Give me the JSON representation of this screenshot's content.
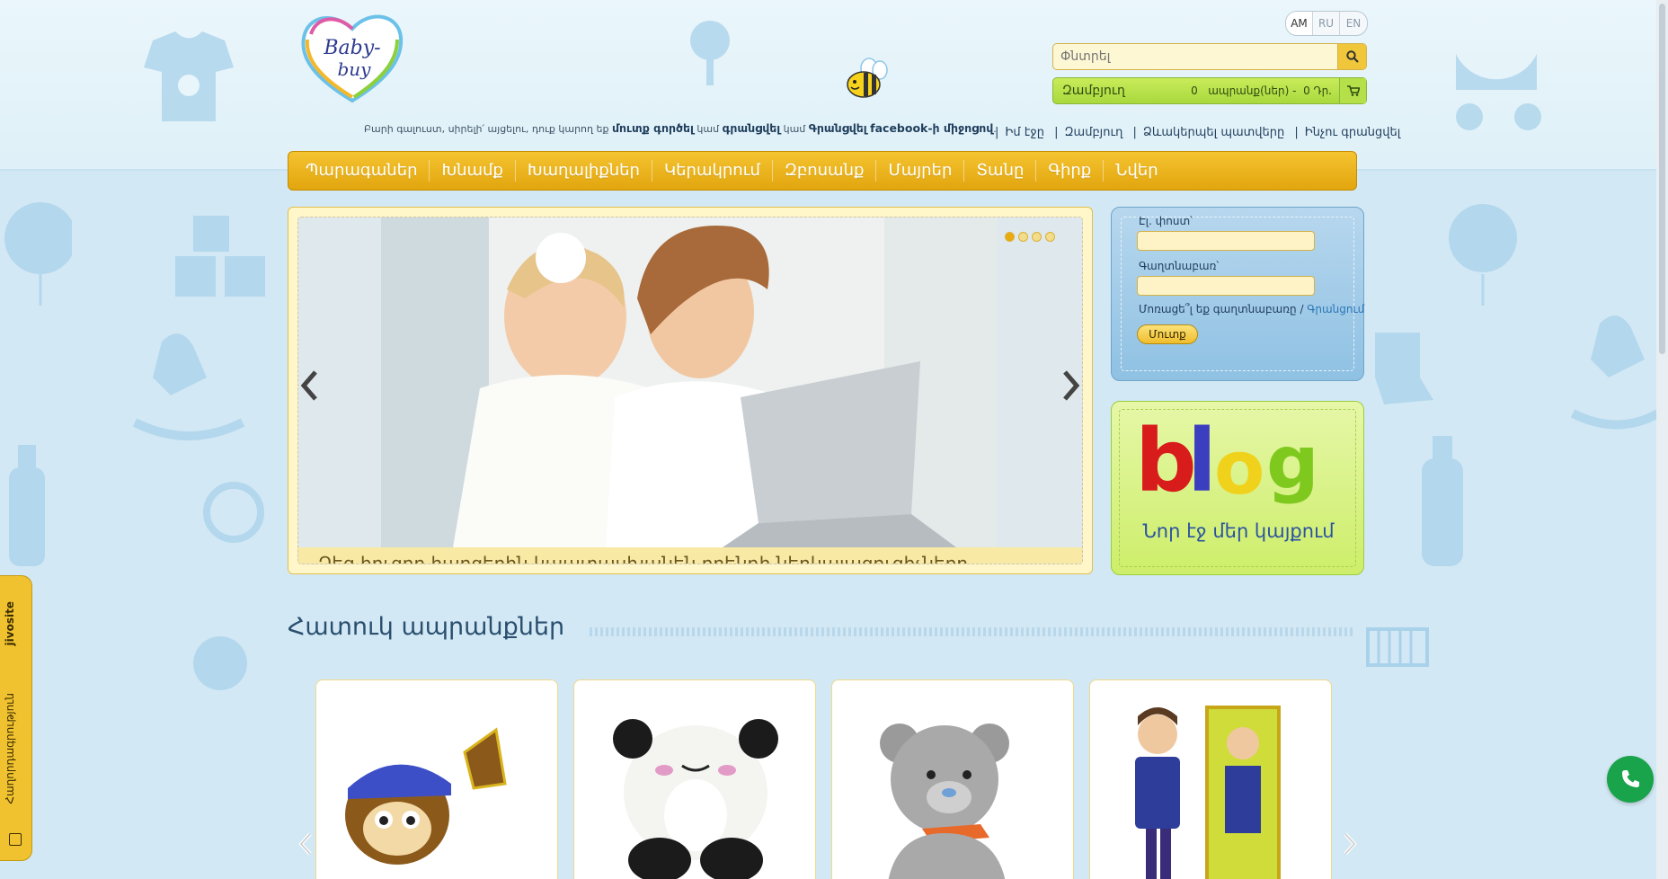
{
  "header": {
    "logo_text_1": "Baby-",
    "logo_text_2": "buy",
    "languages": [
      "AM",
      "RU",
      "EN"
    ],
    "active_language": "AM",
    "search_placeholder": "Փնտրել",
    "cart": {
      "label": "Զամբյուղ",
      "count": "0",
      "items_text": "ապրանք(ներ) -",
      "total": "0 Դր."
    },
    "welcome": {
      "prefix": "Բարի գալուստ, սիրելի՛ այցելու, դուք կարող եք",
      "login": "մուտք գործել",
      "or1": "կամ",
      "register": "գրանցվել",
      "or2": "կամ",
      "fb_register": "Գրանցվել",
      "fb_via": "facebook-ի միջոցով",
      "suffix": "."
    },
    "top_links": [
      "Իմ էջը",
      "Զամբյուղ",
      "Ձևակերպել պատվերը",
      "Ինչու գրանցվել"
    ]
  },
  "nav": {
    "items": [
      "Պարագաներ",
      "Խնամք",
      "Խաղալիքներ",
      "Կերակրում",
      "Զբոսանք",
      "Մայրեր",
      "Տանը",
      "Գիրք",
      "Նվեր"
    ]
  },
  "slider": {
    "caption": "Ձեզ հուզող հարցերին կպատասխանեն բրենդի ներկայացուցիչները...",
    "dots": 4,
    "active_dot": 1
  },
  "login": {
    "email_label": "Էլ. փոստ՝",
    "password_label": "Գաղտնաբառ՝",
    "forgot": "Մոռացե՞լ եք գաղտնաբառը",
    "register_link": "Գրանցում",
    "submit": "Մուտք"
  },
  "blog": {
    "word": "blog",
    "tagline": "Նոր էջ մեր կայքում"
  },
  "featured": {
    "title": "Հատուկ ապրանքներ"
  },
  "side_tab": {
    "brand": "jivosite",
    "text": "Հաղորդագրություն"
  },
  "colors": {
    "nav_bg": "#f0b720",
    "cart_bg": "#b6e04a",
    "accent_blue": "#2b53a0",
    "phone_green": "#19a34a"
  }
}
